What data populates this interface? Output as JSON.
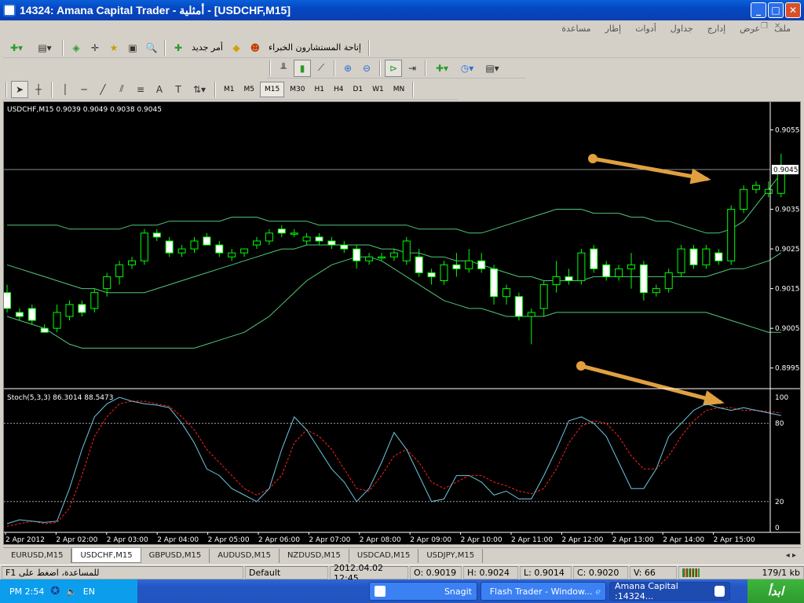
{
  "window": {
    "title": "14324: Amana Capital Trader - أمثلية - [USDCHF,M15]",
    "min": "_",
    "max": "□",
    "close": "✕"
  },
  "menu": [
    "ملف",
    "عرض",
    "إدارج",
    "جداول",
    "أدوات",
    "إطار",
    "مساعدة"
  ],
  "toolbar1": {
    "experts_label": "إتاحة المستشارون الخبراء",
    "new_order_label": "أمر جديد"
  },
  "toolbar3": {
    "timeframes": [
      "M1",
      "M5",
      "M15",
      "M30",
      "H1",
      "H4",
      "D1",
      "W1",
      "MN"
    ],
    "active": "M15",
    "text_tool": "A"
  },
  "chart_data": [
    {
      "type": "candlestick",
      "symbol_label": "USDCHF,M15  0.9039 0.9049 0.9038 0.9045",
      "ylim": [
        0.899,
        0.9062
      ],
      "y_ticks": [
        "0.9055",
        "0.9035",
        "0.9025",
        "0.9015",
        "0.9005",
        "0.8995"
      ],
      "y_tick_values": [
        0.9055,
        0.9035,
        0.9025,
        0.9015,
        0.9005,
        0.8995
      ],
      "current_price": "0.9045",
      "current_value": 0.9045,
      "x_labels": [
        "2 Apr 2012",
        "2 Apr 02:00",
        "2 Apr 03:00",
        "2 Apr 04:00",
        "2 Apr 05:00",
        "2 Apr 06:00",
        "2 Apr 07:00",
        "2 Apr 08:00",
        "2 Apr 09:00",
        "2 Apr 10:00",
        "2 Apr 11:00",
        "2 Apr 12:00",
        "2 Apr 13:00",
        "2 Apr 14:00",
        "2 Apr 15:00"
      ],
      "candles": [
        [
          0.9014,
          0.9016,
          0.9009,
          0.901
        ],
        [
          0.9009,
          0.901,
          0.9007,
          0.9008
        ],
        [
          0.901,
          0.9011,
          0.9006,
          0.9007
        ],
        [
          0.9005,
          0.9006,
          0.9004,
          0.9004
        ],
        [
          0.9005,
          0.9011,
          0.9004,
          0.9009
        ],
        [
          0.9008,
          0.9012,
          0.9007,
          0.9011
        ],
        [
          0.9011,
          0.9012,
          0.9008,
          0.9009
        ],
        [
          0.901,
          0.9015,
          0.9009,
          0.9014
        ],
        [
          0.9015,
          0.9019,
          0.9013,
          0.9018
        ],
        [
          0.9018,
          0.9022,
          0.9016,
          0.9021
        ],
        [
          0.9021,
          0.9023,
          0.902,
          0.9022
        ],
        [
          0.9022,
          0.903,
          0.9021,
          0.9029
        ],
        [
          0.9029,
          0.903,
          0.9027,
          0.9028
        ],
        [
          0.9027,
          0.9028,
          0.9023,
          0.9024
        ],
        [
          0.9024,
          0.9026,
          0.9023,
          0.9025
        ],
        [
          0.9025,
          0.9028,
          0.9024,
          0.9027
        ],
        [
          0.9028,
          0.9029,
          0.9026,
          0.9026
        ],
        [
          0.9026,
          0.9027,
          0.9023,
          0.9024
        ],
        [
          0.9023,
          0.9025,
          0.9022,
          0.9024
        ],
        [
          0.9024,
          0.9025,
          0.9023,
          0.9025
        ],
        [
          0.9026,
          0.9028,
          0.9025,
          0.9027
        ],
        [
          0.9027,
          0.903,
          0.9026,
          0.9029
        ],
        [
          0.903,
          0.9031,
          0.9028,
          0.9029
        ],
        [
          0.9029,
          0.903,
          0.9028,
          0.9029
        ],
        [
          0.9027,
          0.9029,
          0.9026,
          0.9028
        ],
        [
          0.9028,
          0.9029,
          0.9026,
          0.9027
        ],
        [
          0.9027,
          0.9028,
          0.9025,
          0.9026
        ],
        [
          0.9026,
          0.9027,
          0.9024,
          0.9025
        ],
        [
          0.9025,
          0.9026,
          0.902,
          0.9022
        ],
        [
          0.9022,
          0.9024,
          0.9021,
          0.9023
        ],
        [
          0.9023,
          0.9024,
          0.9022,
          0.9023
        ],
        [
          0.9023,
          0.9025,
          0.9022,
          0.9024
        ],
        [
          0.9022,
          0.9028,
          0.9021,
          0.9027
        ],
        [
          0.9023,
          0.9025,
          0.9018,
          0.9019
        ],
        [
          0.9019,
          0.902,
          0.9016,
          0.9018
        ],
        [
          0.9017,
          0.9022,
          0.9016,
          0.9021
        ],
        [
          0.9021,
          0.9024,
          0.9018,
          0.902
        ],
        [
          0.902,
          0.9025,
          0.9019,
          0.9022
        ],
        [
          0.9022,
          0.9024,
          0.9019,
          0.902
        ],
        [
          0.902,
          0.9021,
          0.9011,
          0.9013
        ],
        [
          0.9013,
          0.9016,
          0.9011,
          0.9015
        ],
        [
          0.9013,
          0.9014,
          0.9007,
          0.9008
        ],
        [
          0.9008,
          0.901,
          0.9001,
          0.9009
        ],
        [
          0.901,
          0.9017,
          0.9008,
          0.9016
        ],
        [
          0.9016,
          0.9022,
          0.9014,
          0.9018
        ],
        [
          0.9018,
          0.902,
          0.9016,
          0.9017
        ],
        [
          0.9017,
          0.9025,
          0.9016,
          0.9024
        ],
        [
          0.9025,
          0.9026,
          0.9019,
          0.902
        ],
        [
          0.9021,
          0.9022,
          0.9017,
          0.9018
        ],
        [
          0.9018,
          0.9021,
          0.9017,
          0.902
        ],
        [
          0.902,
          0.9024,
          0.9015,
          0.9021
        ],
        [
          0.9021,
          0.9022,
          0.9012,
          0.9014
        ],
        [
          0.9014,
          0.9016,
          0.9013,
          0.9015
        ],
        [
          0.9015,
          0.902,
          0.9014,
          0.9019
        ],
        [
          0.9019,
          0.9026,
          0.9018,
          0.9025
        ],
        [
          0.9025,
          0.9026,
          0.902,
          0.9021
        ],
        [
          0.9021,
          0.9026,
          0.902,
          0.9025
        ],
        [
          0.9024,
          0.9025,
          0.9021,
          0.9022
        ],
        [
          0.9022,
          0.9036,
          0.9021,
          0.9035
        ],
        [
          0.9035,
          0.9041,
          0.9034,
          0.904
        ],
        [
          0.904,
          0.9042,
          0.9039,
          0.9041
        ],
        [
          0.9039,
          0.9042,
          0.9038,
          0.904
        ],
        [
          0.9039,
          0.9049,
          0.9038,
          0.9045
        ]
      ],
      "bb_upper": [
        0.9031,
        0.9031,
        0.9031,
        0.9031,
        0.9031,
        0.903,
        0.903,
        0.903,
        0.903,
        0.903,
        0.9031,
        0.9031,
        0.9031,
        0.9032,
        0.9032,
        0.9032,
        0.9032,
        0.9032,
        0.9033,
        0.9033,
        0.9033,
        0.9032,
        0.9032,
        0.9032,
        0.9032,
        0.9031,
        0.9031,
        0.9031,
        0.9031,
        0.9031,
        0.9031,
        0.9031,
        0.9031,
        0.903,
        0.903,
        0.903,
        0.903,
        0.9029,
        0.9029,
        0.903,
        0.9031,
        0.9032,
        0.9033,
        0.9034,
        0.9035,
        0.9035,
        0.9035,
        0.9034,
        0.9034,
        0.9034,
        0.9033,
        0.9033,
        0.9032,
        0.9032,
        0.9031,
        0.903,
        0.9029,
        0.9029,
        0.903,
        0.9032,
        0.9036,
        0.904,
        0.9044
      ],
      "bb_middle": [
        0.9021,
        0.902,
        0.9019,
        0.9018,
        0.9017,
        0.9016,
        0.9015,
        0.9015,
        0.9014,
        0.9014,
        0.9014,
        0.9014,
        0.9015,
        0.9016,
        0.9017,
        0.9018,
        0.9019,
        0.902,
        0.9021,
        0.9022,
        0.9023,
        0.9024,
        0.9025,
        0.9025,
        0.9026,
        0.9026,
        0.9026,
        0.9026,
        0.9026,
        0.9026,
        0.9025,
        0.9025,
        0.9024,
        0.9024,
        0.9023,
        0.9023,
        0.9022,
        0.9022,
        0.9021,
        0.902,
        0.9019,
        0.9018,
        0.9018,
        0.9017,
        0.9017,
        0.9017,
        0.9017,
        0.9018,
        0.9018,
        0.9018,
        0.9018,
        0.9018,
        0.9018,
        0.9018,
        0.9018,
        0.9018,
        0.9018,
        0.9019,
        0.902,
        0.902,
        0.9021,
        0.9022,
        0.9024
      ],
      "bb_lower": [
        0.9008,
        0.9007,
        0.9006,
        0.9005,
        0.9003,
        0.9001,
        0.9,
        0.9,
        0.9,
        0.9,
        0.9,
        0.9,
        0.9,
        0.9,
        0.9,
        0.9,
        0.9001,
        0.9002,
        0.9003,
        0.9004,
        0.9006,
        0.9008,
        0.9011,
        0.9014,
        0.9017,
        0.9019,
        0.9021,
        0.9022,
        0.9023,
        0.9023,
        0.9022,
        0.902,
        0.9018,
        0.9016,
        0.9014,
        0.9012,
        0.9011,
        0.901,
        0.901,
        0.9009,
        0.9008,
        0.9008,
        0.9008,
        0.9008,
        0.9009,
        0.9009,
        0.9009,
        0.9009,
        0.9009,
        0.9009,
        0.9009,
        0.9009,
        0.9009,
        0.9009,
        0.9009,
        0.9009,
        0.9009,
        0.9008,
        0.9007,
        0.9006,
        0.9005,
        0.9004,
        0.9004
      ]
    },
    {
      "type": "line",
      "label": "Stoch(5,3,3) 86.3014 88.5473",
      "ylim": [
        0,
        100
      ],
      "y_ticks": [
        "100",
        "80",
        "20",
        "0"
      ],
      "y_tick_values": [
        100,
        80,
        20,
        0
      ],
      "levels": [
        80,
        20
      ],
      "main": [
        3,
        6,
        5,
        4,
        5,
        30,
        60,
        85,
        95,
        100,
        97,
        95,
        94,
        92,
        80,
        65,
        45,
        40,
        30,
        25,
        20,
        30,
        60,
        85,
        75,
        60,
        45,
        35,
        20,
        30,
        50,
        73,
        60,
        40,
        20,
        22,
        40,
        40,
        35,
        25,
        28,
        22,
        22,
        40,
        60,
        82,
        85,
        80,
        70,
        50,
        30,
        30,
        45,
        70,
        80,
        90,
        95,
        92,
        90,
        92,
        90,
        88,
        86
      ],
      "signal": [
        1,
        3,
        5,
        3,
        4,
        15,
        40,
        70,
        85,
        95,
        97,
        97,
        95,
        93,
        85,
        75,
        60,
        50,
        40,
        30,
        25,
        30,
        40,
        65,
        75,
        70,
        60,
        45,
        30,
        28,
        40,
        55,
        60,
        50,
        35,
        30,
        35,
        40,
        40,
        35,
        32,
        28,
        26,
        30,
        45,
        65,
        78,
        82,
        80,
        70,
        55,
        45,
        45,
        55,
        70,
        82,
        90,
        92,
        92,
        90,
        90,
        89,
        88
      ]
    }
  ],
  "tabs": [
    "EURUSD,M15",
    "USDCHF,M15",
    "GBPUSD,M15",
    "AUDUSD,M15",
    "NZDUSD,M15",
    "USDCAD,M15",
    "USDJPY,M15"
  ],
  "status": {
    "help": "للمساعدة، اضغط على F1",
    "profile": "Default",
    "datetime": "2012.04.02 12:45",
    "open": "O: 0.9019",
    "high": "H: 0.9024",
    "low": "L: 0.9014",
    "close": "C: 0.9020",
    "volume": "V: 66",
    "traffic": "179/1 kb"
  },
  "taskbar": {
    "clock": "PM 2:54",
    "lang": "EN",
    "snagit": "Snagit",
    "task1": "Flash Trader - Window...",
    "task2": "Amana Capital :14324...",
    "start": "ابدأ"
  },
  "colors": {
    "up": "#00ff00",
    "down": "#ffffff",
    "bands": "#50c878",
    "stoch_main": "#6ec6e0",
    "stoch_signal": "#ff2020",
    "annotation": "#e0a040"
  }
}
